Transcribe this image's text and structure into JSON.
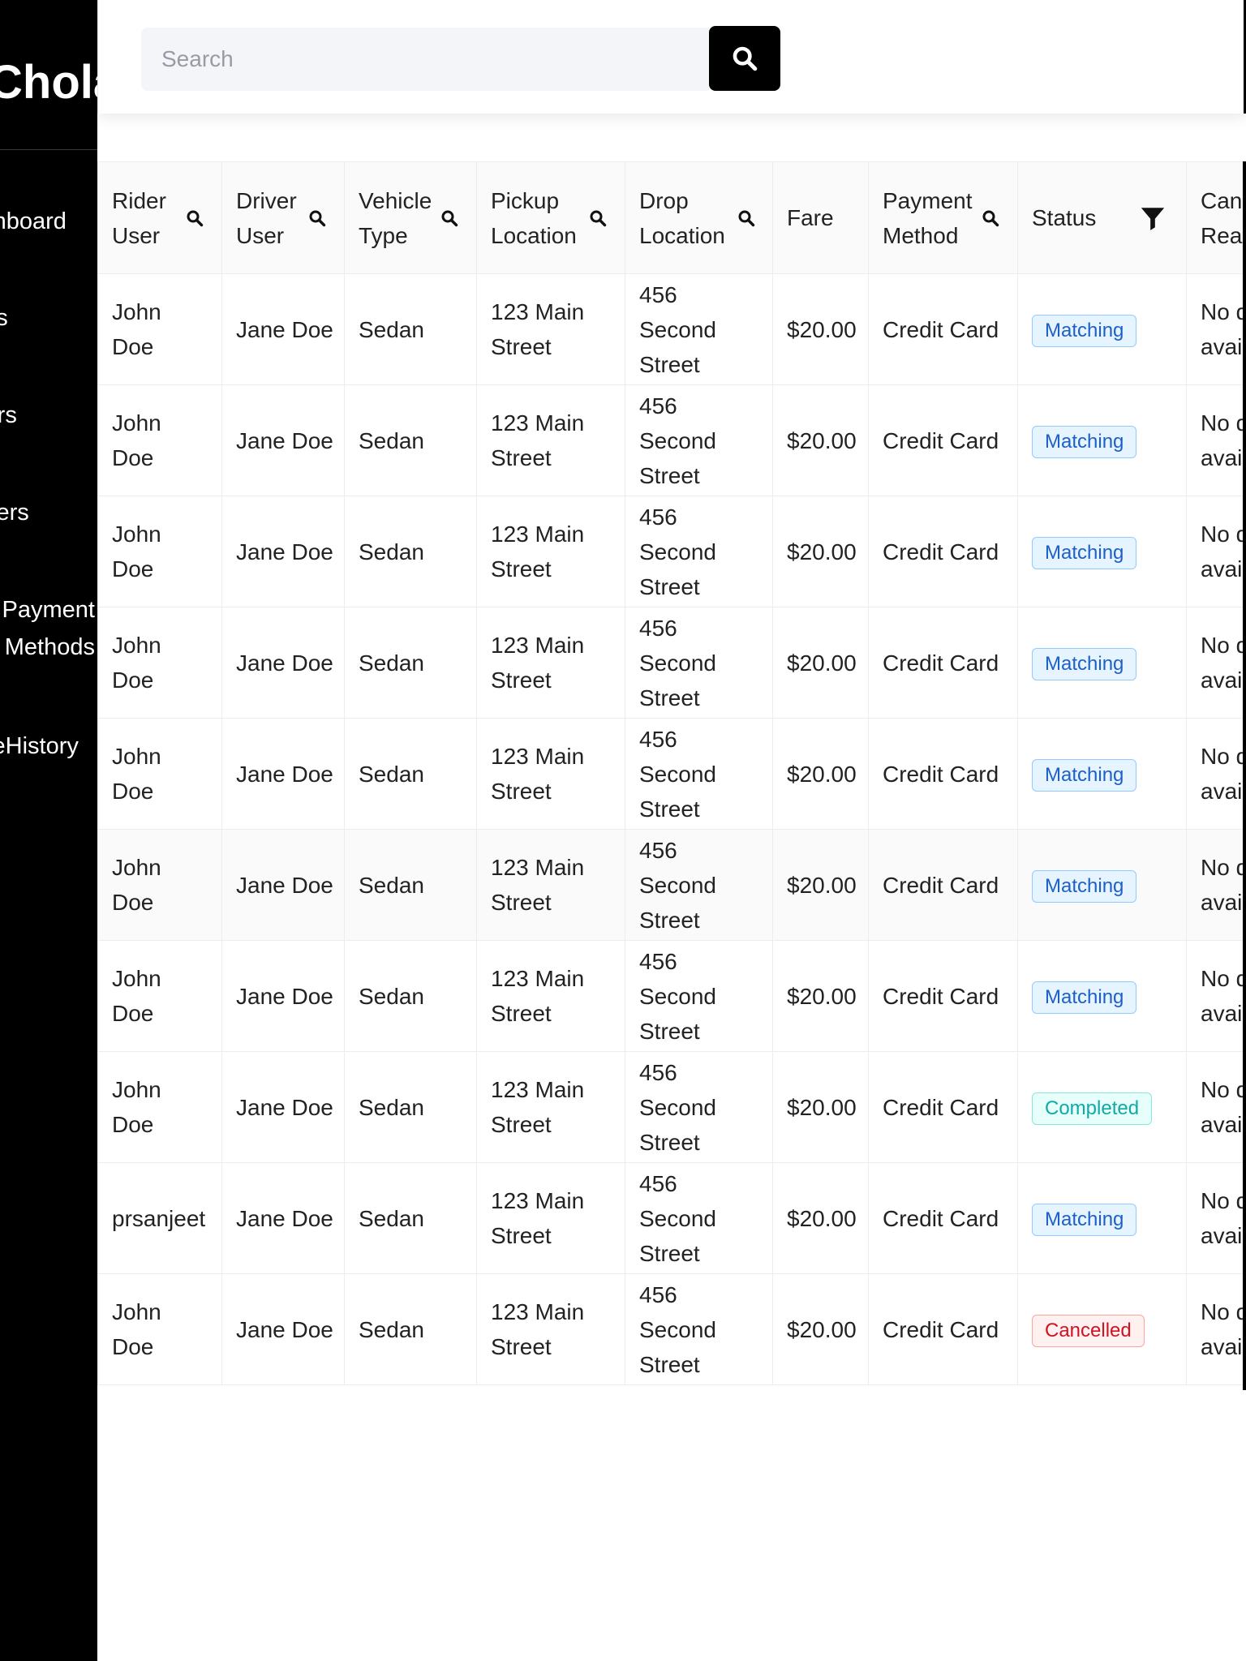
{
  "sidebar": {
    "brand": "Chola",
    "items": [
      {
        "label": "Dashboard"
      },
      {
        "label": "Users"
      },
      {
        "label": "Drivers"
      },
      {
        "label": "Riders"
      },
      {
        "label": "Payment Methods"
      },
      {
        "label": "RideHistory"
      }
    ],
    "background": "#000000"
  },
  "search": {
    "placeholder": "Search",
    "button_icon": "search-icon"
  },
  "table": {
    "headers": [
      {
        "label": "Rider User",
        "icon": "search-icon"
      },
      {
        "label": "Driver User",
        "icon": "search-icon"
      },
      {
        "label": "Vehicle Type",
        "icon": "search-icon"
      },
      {
        "label": "Pickup Location",
        "icon": "search-icon"
      },
      {
        "label": "Drop Location",
        "icon": "search-icon"
      },
      {
        "label": "Fare",
        "icon": null
      },
      {
        "label": "Payment Method",
        "icon": "search-icon"
      },
      {
        "label": "Status",
        "icon": "filter-icon"
      },
      {
        "label": "Cancel Reason",
        "icon": null
      }
    ],
    "rows": [
      {
        "rider": "John Doe",
        "driver": "Jane Doe",
        "vehicle": "Sedan",
        "pickup": "123 Main Street",
        "drop": "456 Second Street",
        "fare": "$20.00",
        "payment": "Credit Card",
        "status": "Matching",
        "cancel_reason": "No d avail"
      },
      {
        "rider": "John Doe",
        "driver": "Jane Doe",
        "vehicle": "Sedan",
        "pickup": "123 Main Street",
        "drop": "456 Second Street",
        "fare": "$20.00",
        "payment": "Credit Card",
        "status": "Matching",
        "cancel_reason": "No d avail"
      },
      {
        "rider": "John Doe",
        "driver": "Jane Doe",
        "vehicle": "Sedan",
        "pickup": "123 Main Street",
        "drop": "456 Second Street",
        "fare": "$20.00",
        "payment": "Credit Card",
        "status": "Matching",
        "cancel_reason": "No d avail"
      },
      {
        "rider": "John Doe",
        "driver": "Jane Doe",
        "vehicle": "Sedan",
        "pickup": "123 Main Street",
        "drop": "456 Second Street",
        "fare": "$20.00",
        "payment": "Credit Card",
        "status": "Matching",
        "cancel_reason": "No d avail"
      },
      {
        "rider": "John Doe",
        "driver": "Jane Doe",
        "vehicle": "Sedan",
        "pickup": "123 Main Street",
        "drop": "456 Second Street",
        "fare": "$20.00",
        "payment": "Credit Card",
        "status": "Matching",
        "cancel_reason": "No d avail"
      },
      {
        "rider": "John Doe",
        "driver": "Jane Doe",
        "vehicle": "Sedan",
        "pickup": "123 Main Street",
        "drop": "456 Second Street",
        "fare": "$20.00",
        "payment": "Credit Card",
        "status": "Matching",
        "cancel_reason": "No d avail"
      },
      {
        "rider": "John Doe",
        "driver": "Jane Doe",
        "vehicle": "Sedan",
        "pickup": "123 Main Street",
        "drop": "456 Second Street",
        "fare": "$20.00",
        "payment": "Credit Card",
        "status": "Matching",
        "cancel_reason": "No d avail"
      },
      {
        "rider": "John Doe",
        "driver": "Jane Doe",
        "vehicle": "Sedan",
        "pickup": "123 Main Street",
        "drop": "456 Second Street",
        "fare": "$20.00",
        "payment": "Credit Card",
        "status": "Completed",
        "cancel_reason": "No d avail"
      },
      {
        "rider": "prsanjeet",
        "driver": "Jane Doe",
        "vehicle": "Sedan",
        "pickup": "123 Main Street",
        "drop": "456 Second Street",
        "fare": "$20.00",
        "payment": "Credit Card",
        "status": "Matching",
        "cancel_reason": "No d avail"
      },
      {
        "rider": "John Doe",
        "driver": "Jane Doe",
        "vehicle": "Sedan",
        "pickup": "123 Main Street",
        "drop": "456 Second Street",
        "fare": "$20.00",
        "payment": "Credit Card",
        "status": "Cancelled",
        "cancel_reason": "No d avail"
      }
    ],
    "highlighted_row": 5
  },
  "status_colors": {
    "Matching": {
      "text": "#1d5fc9",
      "bg": "#e6f4ff",
      "border": "#91caff"
    },
    "Completed": {
      "text": "#13a8a8",
      "bg": "#e6fffb",
      "border": "#87e8de"
    },
    "Cancelled": {
      "text": "#cf1322",
      "bg": "#fff1f0",
      "border": "#ffa39e"
    }
  }
}
